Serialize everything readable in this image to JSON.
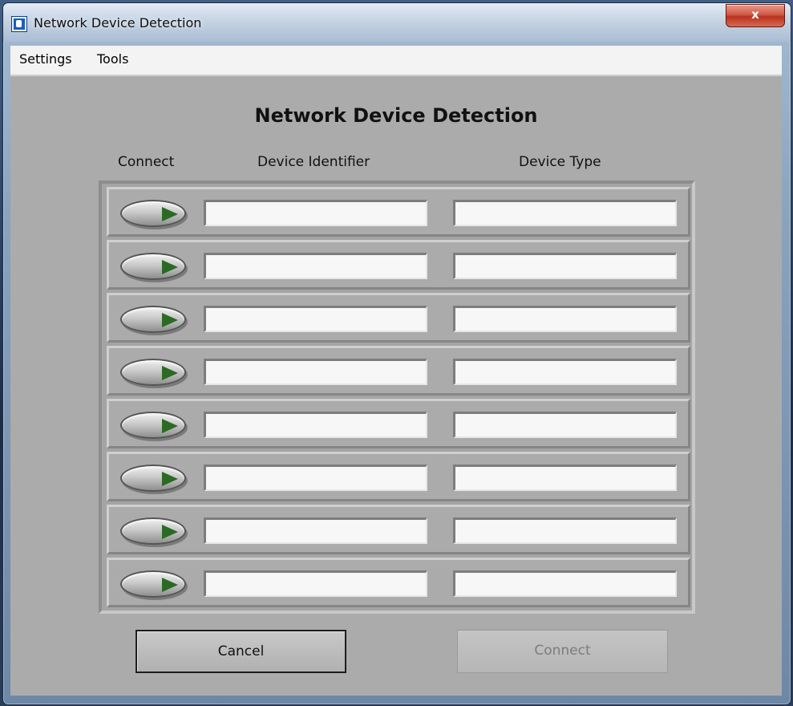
{
  "window": {
    "title": "Network Device Detection",
    "close_label": "x"
  },
  "menu": {
    "items": [
      {
        "label": "Settings"
      },
      {
        "label": "Tools"
      }
    ]
  },
  "main": {
    "heading": "Network Device Detection",
    "columns": {
      "connect": "Connect",
      "identifier": "Device Identifier",
      "type": "Device Type"
    },
    "rows": [
      {
        "identifier": "",
        "type": ""
      },
      {
        "identifier": "",
        "type": ""
      },
      {
        "identifier": "",
        "type": ""
      },
      {
        "identifier": "",
        "type": ""
      },
      {
        "identifier": "",
        "type": ""
      },
      {
        "identifier": "",
        "type": ""
      },
      {
        "identifier": "",
        "type": ""
      },
      {
        "identifier": "",
        "type": ""
      }
    ]
  },
  "buttons": {
    "cancel": "Cancel",
    "connect": "Connect",
    "connect_enabled": false
  },
  "colors": {
    "panel": "#ababab",
    "led_arrow": "#2b6a24"
  }
}
